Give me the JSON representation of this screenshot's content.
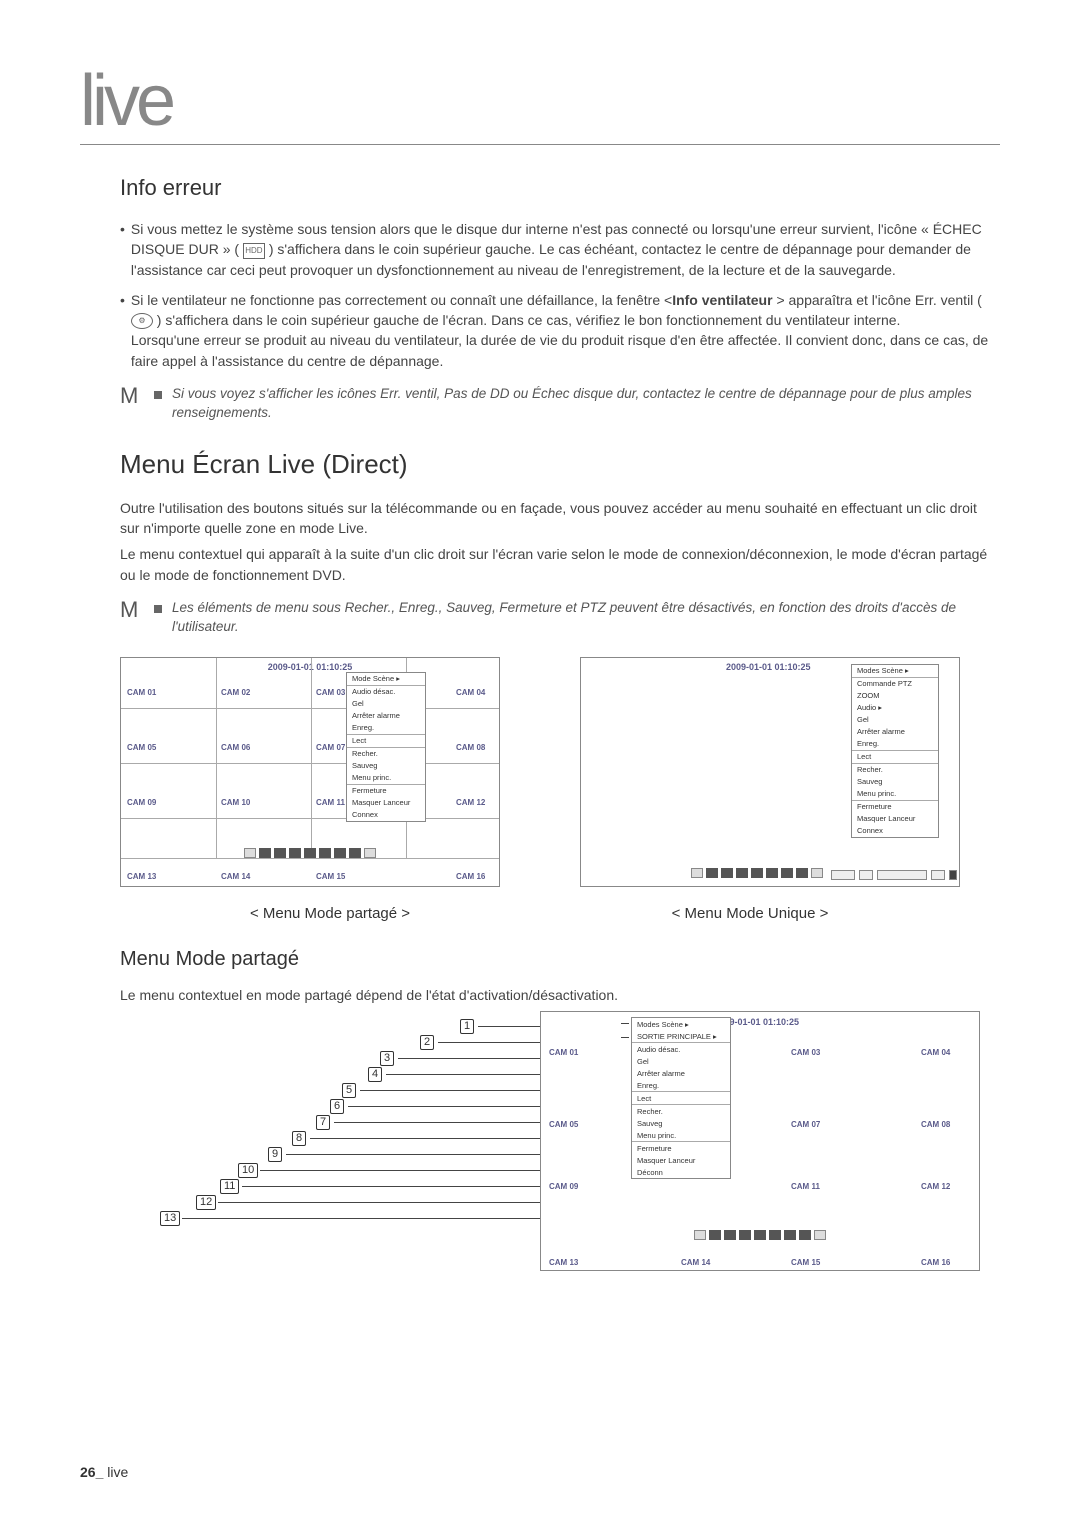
{
  "page": {
    "title": "live",
    "footer_num": "26_",
    "footer_text": " live"
  },
  "s1": {
    "heading": "Info erreur",
    "b1": "Si vous mettez le système sous tension alors que le disque dur interne n'est pas connecté ou lorsqu'une erreur survient, l'icône « ÉCHEC DISQUE DUR » ( ",
    "b1_icon": "HDD",
    "b1_cont": " ) s'affichera dans le coin supérieur gauche. Le cas échéant, contactez le centre de dépannage pour demander de l'assistance car ceci peut provoquer un dysfonctionnement au niveau de l'enregistrement, de la lecture et de la sauvegarde.",
    "b2a": "Si le ventilateur ne fonctionne pas correctement ou connaît une défaillance, la fenêtre <",
    "b2b": "Info ventilateur",
    "b2c": " > apparaîtra et l'icône Err. ventil ( ",
    "b2_icon": "⚙",
    "b2d": " ) s'affichera dans le coin supérieur gauche de l'écran. Dans ce cas, vérifiez le bon fonctionnement du ventilateur interne.",
    "b2e": "Lorsqu'une erreur se produit au niveau du ventilateur, la durée de vie du produit risque d'en être affectée. Il convient donc, dans ce cas, de faire appel à l'assistance du centre de dépannage.",
    "note": "Si vous voyez s'afficher les icônes Err. ventil, Pas de DD ou Échec disque dur, contactez le centre de dépannage pour de plus amples renseignements."
  },
  "s2": {
    "heading": "Menu Écran Live (Direct)",
    "p1": "Outre l'utilisation des boutons situés sur la télécommande ou en façade, vous pouvez accéder au menu souhaité en effectuant un clic droit sur n'importe quelle zone en mode Live.",
    "p2": "Le menu contextuel qui apparaît à la suite d'un clic droit sur l'écran varie selon le mode de connexion/déconnexion, le mode d'écran partagé ou le mode de fonctionnement DVD.",
    "note": "Les éléments de menu sous Recher., Enreg., Sauveg, Fermeture et PTZ peuvent être désactivés, en fonction des droits d'accès de l'utilisateur.",
    "cap_left": "< Menu Mode partagé >",
    "cap_right": "< Menu Mode Unique >"
  },
  "s3": {
    "heading": "Menu Mode partagé",
    "p1": "Le menu contextuel en mode partagé dépend de l'état d'activation/désactivation."
  },
  "screens": {
    "timestamp": "2009-01-01 01:10:25",
    "cams": [
      "CAM 01",
      "CAM 02",
      "CAM 03",
      "CAM 04",
      "CAM 05",
      "CAM 06",
      "CAM 07",
      "CAM 08",
      "CAM 09",
      "CAM 10",
      "CAM 11",
      "CAM 12",
      "CAM 13",
      "CAM 14",
      "CAM 15",
      "CAM 16"
    ],
    "menu_shared": [
      "Mode Scène   ▸",
      "Audio désac.",
      "Gel",
      "Arrêter alarme",
      "Enreg.",
      "Lect",
      "Recher.",
      "Sauveg",
      "Menu princ.",
      "Fermeture",
      "Masquer Lanceur",
      "Connex"
    ],
    "menu_unique": [
      "Modes Scène ▸",
      "Commande PTZ",
      "ZOOM",
      "Audio        ▸",
      "Gel",
      "Arrêter alarme",
      "Enreg.",
      "Lect",
      "Recher.",
      "Sauveg",
      "Menu princ.",
      "Fermeture",
      "Masquer Lanceur",
      "Connex"
    ],
    "menu_big_items": [
      "Modes Scène    ▸",
      "SORTIE PRINCIPALE ▸",
      "Audio désac.",
      "Gel",
      "Arrêter alarme",
      "Enreg.",
      "Lect",
      "Recher.",
      "Sauveg",
      "Menu princ.",
      "Fermeture",
      "Masquer Lanceur",
      "Déconn"
    ]
  },
  "callouts": [
    "1",
    "2",
    "3",
    "4",
    "5",
    "6",
    "7",
    "8",
    "9",
    "10",
    "11",
    "12",
    "13"
  ]
}
